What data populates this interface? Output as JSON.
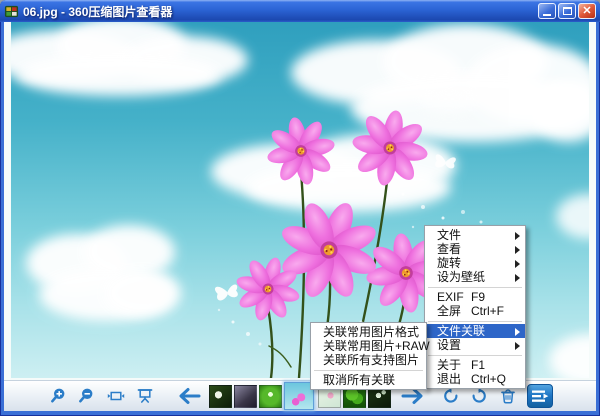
{
  "window": {
    "title": "06.jpg - 360压缩图片查看器"
  },
  "photo": {
    "description": "蓝天白云下的粉色波斯菊与白色蝴蝶"
  },
  "context_menu": {
    "items": [
      {
        "label": "文件",
        "has_submenu": true
      },
      {
        "label": "查看",
        "has_submenu": true
      },
      {
        "label": "旋转",
        "has_submenu": true
      },
      {
        "label": "设为壁纸",
        "has_submenu": true
      },
      {
        "label": "EXIF",
        "shortcut": "F9"
      },
      {
        "label": "全屏",
        "shortcut": "Ctrl+F"
      },
      {
        "label": "文件关联",
        "has_submenu": true,
        "highlighted": true
      },
      {
        "label": "设置",
        "has_submenu": true
      },
      {
        "label": "关于",
        "shortcut": "F1"
      },
      {
        "label": "退出",
        "shortcut": "Ctrl+Q"
      }
    ]
  },
  "submenu": {
    "items": [
      "关联常用图片格式",
      "关联常用图片+RAW",
      "关联所有支持图片",
      "取消所有关联"
    ]
  },
  "toolbar": {
    "buttons": [
      "zoom-in",
      "zoom-out",
      "fit-to-window",
      "slideshow",
      "previous-image",
      "next-image",
      "rotate-left",
      "rotate-right",
      "delete-image",
      "main-menu"
    ]
  },
  "thumbnails": {
    "selected_index": 3,
    "items": [
      {
        "style": "background:radial-gradient(circle at 40% 42%, #eef4e6 0 20%, transparent 21%), linear-gradient(140deg,#2a4a18,#0d1c08)"
      },
      {
        "style": "background:linear-gradient(140deg,#8a86a0,#3a3648 60%,#201d2c)"
      },
      {
        "style": "background:radial-gradient(circle at 50% 40%, #eaffd8 0 14%, transparent 15%), radial-gradient(circle at 50% 50%, #56b82a 0 55%, #2a7a12 100%)"
      },
      {
        "style": "background:radial-gradient(circle at 58% 55%, #ee6fd8 0 18%, transparent 19%), radial-gradient(circle at 38% 72%, #e860d2 0 14%, transparent 15%), linear-gradient(180deg,#6cc6de,#b4e6ee)"
      },
      {
        "style": "background:radial-gradient(circle at 55% 45%, #f0a8c8 0 18%, transparent 19%), linear-gradient(150deg,#eaf4e6,#cfe6d4)"
      },
      {
        "style": "background:radial-gradient(circle at 38% 40%, #5cc428 0 34%, transparent 35%), radial-gradient(circle at 64% 60%, #44aa1c 0 30%, transparent 31%), linear-gradient(#237a10,#145008)"
      },
      {
        "style": "background:radial-gradient(circle at 45% 45%, #dff0d8 0 16%, transparent 17%), radial-gradient(circle at 70% 30%, #cfe8c8 0 10%, transparent 11%), linear-gradient(150deg,#1e3a14,#0c1808)"
      }
    ]
  },
  "colors": {
    "titlebar": "#2b63d4",
    "toolbar_icon": "#2b7dc8",
    "menu_highlight": "#2e66c8",
    "sky_top": "#2f9fbe",
    "sky_bottom": "#cdeff2",
    "close_button": "#d94a2b"
  }
}
